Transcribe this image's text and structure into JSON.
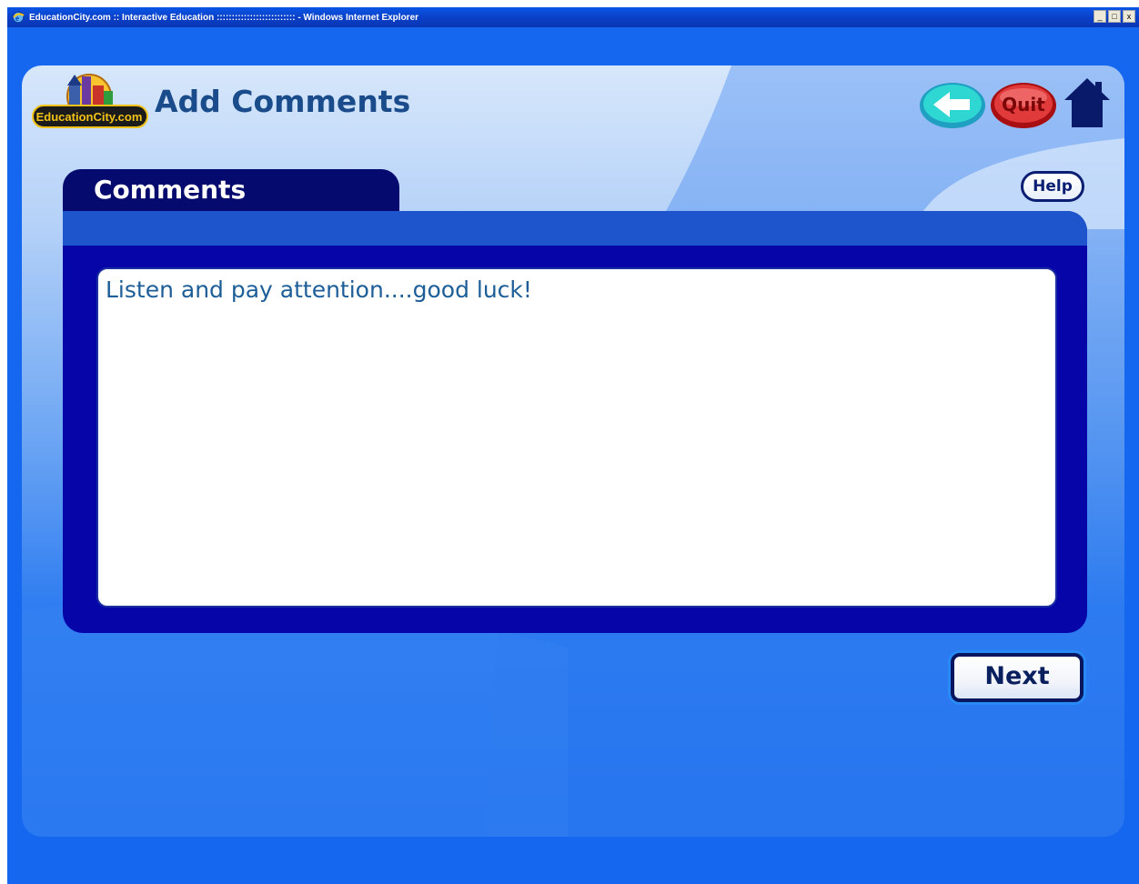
{
  "window": {
    "title": "EducationCity.com :: Interactive Education :::::::::::::::::::::::::: - Windows Internet Explorer",
    "controls": {
      "minimize": "_",
      "maximize": "□",
      "close": "x"
    }
  },
  "header": {
    "logo_text": "EducationCity.com",
    "title": "Add Comments"
  },
  "nav": {
    "quit_label": "Quit"
  },
  "panel": {
    "tab_label": "Comments",
    "help_label": "Help",
    "comment_text": "Listen and pay attention....good luck!",
    "next_label": "Next"
  },
  "colors": {
    "accent": "#1a4c8c",
    "panel_dark": "#0505a8",
    "tab": "#050a6e",
    "back_button": "#2fd7d2",
    "quit_button": "#e13a3a",
    "home_icon": "#0a1a6b"
  }
}
